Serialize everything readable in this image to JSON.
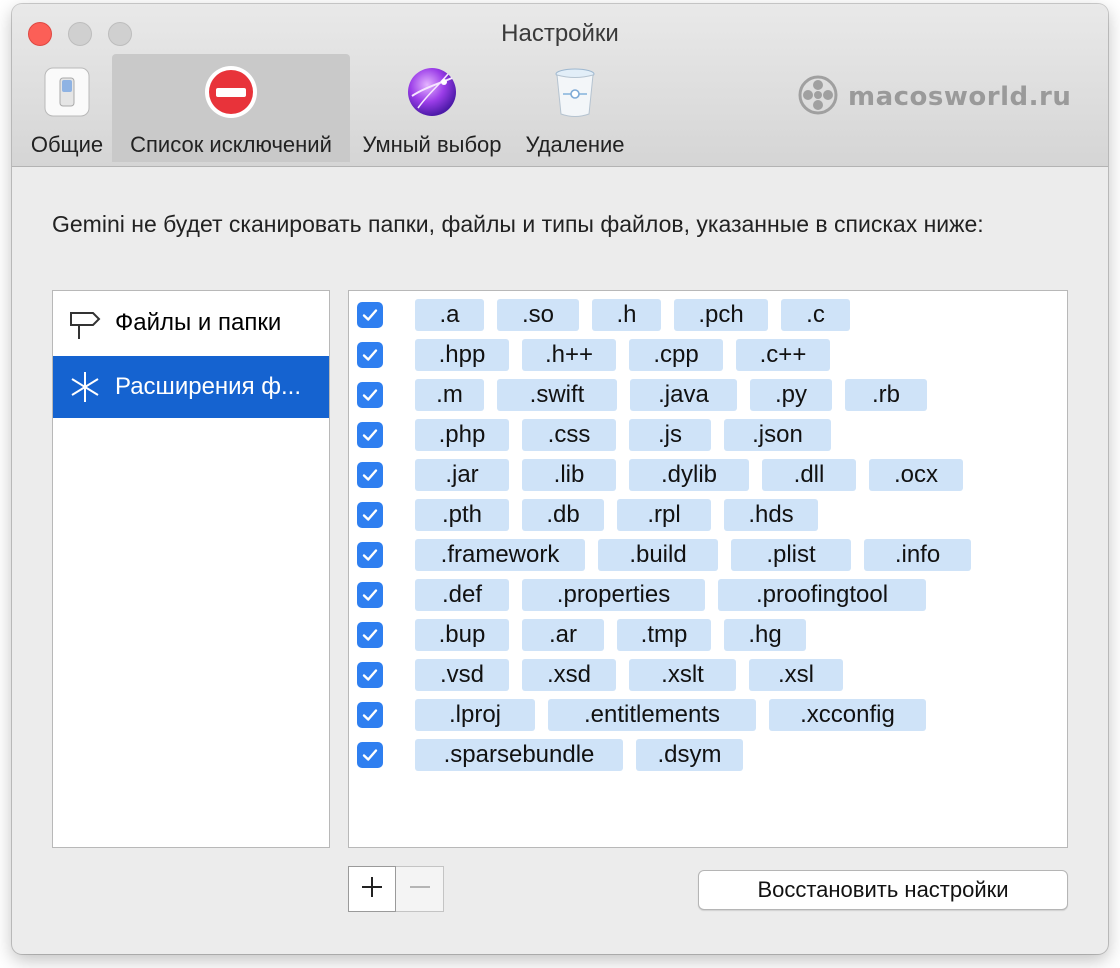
{
  "window": {
    "title": "Настройки"
  },
  "toolbar": {
    "items": [
      {
        "label": "Общие",
        "icon": "switch-icon"
      },
      {
        "label": "Список исключений",
        "icon": "no-entry-icon",
        "selected": true
      },
      {
        "label": "Умный выбор",
        "icon": "sphere-icon"
      },
      {
        "label": "Удаление",
        "icon": "trash-icon"
      }
    ],
    "brand": "macosworld.ru"
  },
  "description": "Gemini не будет сканировать папки, файлы и типы файлов, указанные в списках ниже:",
  "sidebar": {
    "items": [
      {
        "label": "Файлы и папки",
        "icon": "signpost-icon",
        "selected": false
      },
      {
        "label": "Расширения ф...",
        "icon": "asterisk-icon",
        "selected": true
      }
    ]
  },
  "extension_rows": [
    {
      "checked": true,
      "items": [
        ".a",
        ".so",
        ".h",
        ".pch",
        ".c"
      ]
    },
    {
      "checked": true,
      "items": [
        ".hpp",
        ".h++",
        ".cpp",
        ".c++"
      ]
    },
    {
      "checked": true,
      "items": [
        ".m",
        ".swift",
        ".java",
        ".py",
        ".rb"
      ]
    },
    {
      "checked": true,
      "items": [
        ".php",
        ".css",
        ".js",
        ".json"
      ]
    },
    {
      "checked": true,
      "items": [
        ".jar",
        ".lib",
        ".dylib",
        ".dll",
        ".ocx"
      ]
    },
    {
      "checked": true,
      "items": [
        ".pth",
        ".db",
        ".rpl",
        ".hds"
      ]
    },
    {
      "checked": true,
      "items": [
        ".framework",
        ".build",
        ".plist",
        ".info"
      ]
    },
    {
      "checked": true,
      "items": [
        ".def",
        ".properties",
        ".proofingtool"
      ]
    },
    {
      "checked": true,
      "items": [
        ".bup",
        ".ar",
        ".tmp",
        ".hg"
      ]
    },
    {
      "checked": true,
      "items": [
        ".vsd",
        ".xsd",
        ".xslt",
        ".xsl"
      ]
    },
    {
      "checked": true,
      "items": [
        ".lproj",
        ".entitlements",
        ".xcconfig"
      ]
    },
    {
      "checked": true,
      "items": [
        ".sparsebundle",
        ".dsym"
      ]
    }
  ],
  "buttons": {
    "add": "+",
    "remove": "−",
    "restore": "Восстановить настройки"
  },
  "colors": {
    "selection": "#1563d0",
    "token": "#cfe3f8",
    "checkbox": "#2f7ff0",
    "close": "#fc5f57"
  }
}
